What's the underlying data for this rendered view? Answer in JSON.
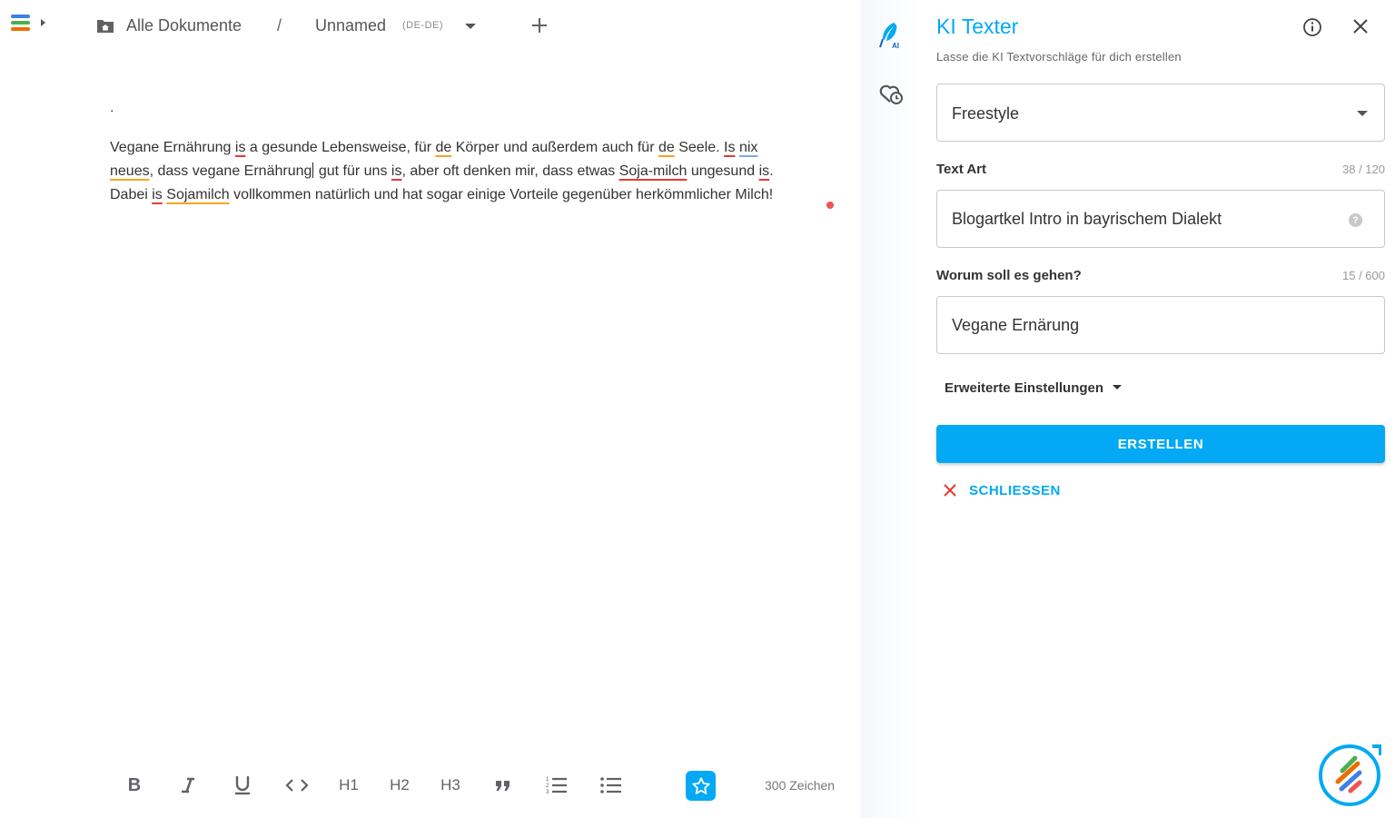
{
  "breadcrumb": {
    "root_label": "Alle Dokumente",
    "separator": "/",
    "document_name": "Unnamed",
    "language": "(DE-DE)"
  },
  "editor": {
    "dot_line": ".",
    "paragraph": {
      "l1": {
        "a": "Vegane Ernährung ",
        "b": "is",
        "c": " a gesunde Lebensweise, für ",
        "d": "de",
        "e": " Körper und außerdem auch für ",
        "f": "de",
        "g": " Seele. ",
        "h": "Is",
        "i": " ",
        "j": "nix"
      },
      "l2": {
        "a": "neues",
        "b": ", dass vegane Ernährung",
        "c": " gut für uns ",
        "d": "is",
        "e": ", aber oft denken mir, dass etwas ",
        "f": "Soja-milch",
        "g": " ungesund ",
        "h": "is",
        "i": "."
      },
      "l3": {
        "a": "Dabei ",
        "b": "is",
        "c": " ",
        "d": "Sojamilch",
        "e": " vollkommen natürlich und hat sogar einige Vorteile gegenüber herkömmlicher Milch!"
      }
    }
  },
  "toolbar": {
    "bold": "B",
    "h1": "H1",
    "h2": "H2",
    "h3": "H3",
    "char_count": "300 Zeichen"
  },
  "panel": {
    "title": "KI Texter",
    "subtitle": "Lasse die KI Textvorschläge für dich erstellen",
    "mode_select": {
      "value": "Freestyle"
    },
    "text_type": {
      "label": "Text Art",
      "count": "38 / 120",
      "value": "Blogartkel Intro in bayrischem Dialekt",
      "help": "?"
    },
    "topic": {
      "label": "Worum soll es gehen?",
      "count": "15 / 600",
      "value": "Vegane Ernärung"
    },
    "advanced_label": "Erweiterte Einstellungen",
    "create_label": "ERSTELLEN",
    "close_label": "SCHLIESSEN"
  },
  "colors": {
    "accent": "#03a9f4",
    "error_underline": "#e53935",
    "warning_underline": "#f5a623",
    "style_underline": "#7aa7e9",
    "close_x": "#e53935"
  },
  "icons": [
    "app-menu-icon",
    "folder-home-icon",
    "plus-icon",
    "ai-feather-icon",
    "heart-clock-icon",
    "info-icon",
    "close-icon",
    "help-icon",
    "x-icon",
    "star-icon",
    "chevron-right-icon",
    "brand-logo-icon"
  ]
}
